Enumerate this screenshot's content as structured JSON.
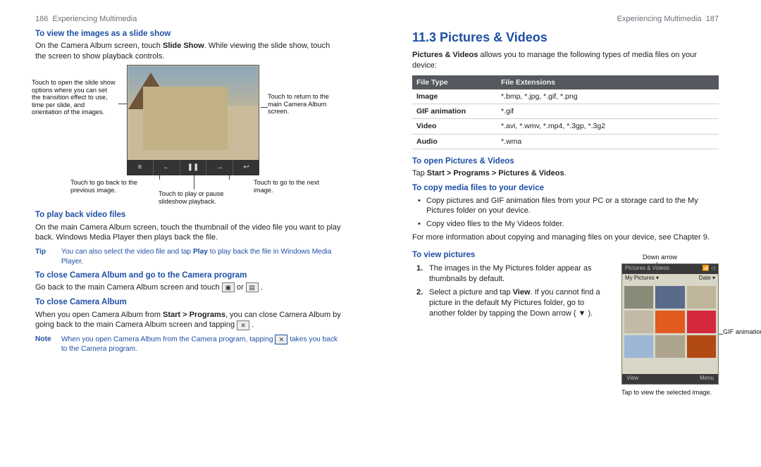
{
  "leftHeader": {
    "pagenum": "186",
    "section": "Experiencing Multimedia"
  },
  "rightHeader": {
    "section": "Experiencing Multimedia",
    "pagenum": "187"
  },
  "left": {
    "h_slide": "To view the images as a slide show",
    "slide_body": "On the Camera Album screen, touch Slide Show. While viewing the slide show, touch the screen to show playback controls.",
    "callouts": {
      "options": "Touch to open the slide show options where you can set the transition effect to use, time per slide, and orientation of the images.",
      "return": "Touch to return to the main Camera Album screen.",
      "prev": "Touch to go back to the previous image.",
      "play": "Touch to play or pause slideshow playback.",
      "next": "Touch to go to the next image."
    },
    "h_play": "To play back video files",
    "play_body": "On the main Camera Album screen, touch the thumbnail of the video file you want to play back. Windows Media Player then plays back the file.",
    "tip_label": "Tip",
    "tip_body": "You can also select the video file and tap Play to play back the file in Windows Media Player.",
    "h_close_cam": "To close Camera Album and go to the Camera program",
    "close_cam_body_a": "Go back to the main Camera Album screen and touch ",
    "close_cam_body_b": " or ",
    "close_cam_body_c": ".",
    "h_close_album": "To close Camera Album",
    "close_album_body_a": "When you open Camera Album from Start > Programs, you can close Camera Album by going back to the main Camera Album screen and tapping ",
    "close_album_body_b": ".",
    "note_label": "Note",
    "note_body_a": "When you open Camera Album from the Camera program, tapping ",
    "note_body_b": " takes you back to the Camera program."
  },
  "right": {
    "h2": "11.3  Pictures & Videos",
    "intro": "Pictures & Videos allows you to manage the following types of media files on your device:",
    "table": {
      "hdr1": "File Type",
      "hdr2": "File Extensions",
      "rows": [
        {
          "t": "Image",
          "e": "*.bmp, *.jpg, *.gif, *.png"
        },
        {
          "t": "GIF animation",
          "e": "*.gif"
        },
        {
          "t": "Video",
          "e": "*.avi, *.wmv, *.mp4, *.3gp, *.3g2"
        },
        {
          "t": "Audio",
          "e": "*.wma"
        }
      ]
    },
    "h_open": "To open Pictures & Videos",
    "open_body": "Tap Start > Programs > Pictures & Videos.",
    "h_copy": "To copy media files to your device",
    "copy_b1": "Copy pictures and GIF animation files from your PC or a storage card to the My Pictures folder on your device.",
    "copy_b2": "Copy video files to the My Videos folder.",
    "more_info": "For more information about copying and managing files on your device, see Chapter 9.",
    "h_view": "To view pictures",
    "viewpics_1": "The images in the My Pictures folder appear as thumbnails by default.",
    "viewpics_2": "Select a picture and tap View. If you cannot find a picture in the default My Pictures folder, go to another folder by tapping the Down arrow ( ▼ ).",
    "fig": {
      "downarrow": "Down arrow",
      "gifanim": "GIF animation icon",
      "tapview": "Tap to view the selected image.",
      "phone_title": "Pictures & Videos",
      "phone_folder": "My Pictures ▾",
      "phone_sort": "Date ▾",
      "phone_view": "View",
      "phone_menu": "Menu"
    }
  }
}
